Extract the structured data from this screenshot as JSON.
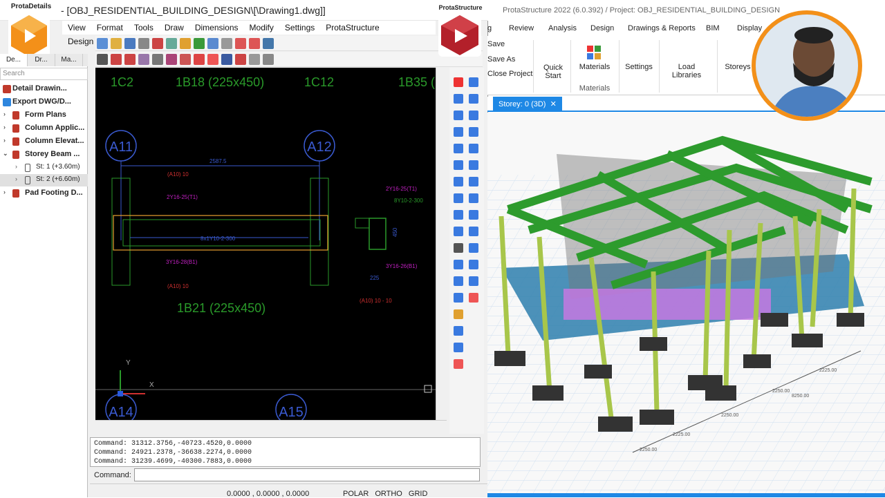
{
  "left_app": {
    "brand": "ProtaDetails",
    "title": "- [OBJ_RESIDENTIAL_BUILDING_DESIGN\\[\\Drawing1.dwg]]",
    "menu": [
      "View",
      "Format",
      "Tools",
      "Draw",
      "Dimensions",
      "Modify",
      "Settings",
      "ProtaStructure",
      "Design Librar"
    ],
    "panel_tabs": [
      "De...",
      "Dr...",
      "Ma..."
    ],
    "search_placeholder": "Search",
    "tree": [
      {
        "label": "Detail Drawin...",
        "color": "#c0392b"
      },
      {
        "label": "Export DWG/D...",
        "color": "#2e86de"
      },
      {
        "label": "Form Plans",
        "color": "#c0392b"
      },
      {
        "label": "Column Applic...",
        "color": "#c0392b"
      },
      {
        "label": "Column Elevat...",
        "color": "#c0392b"
      },
      {
        "label": "Storey Beam ...",
        "color": "#c0392b"
      },
      {
        "label": "St: 1 (+3.60m)",
        "color": "#555"
      },
      {
        "label": "St: 2 (+6.60m)",
        "color": "#555"
      },
      {
        "label": "Pad Footing D...",
        "color": "#c0392b"
      }
    ],
    "drawing": {
      "top_labels": [
        "1C2",
        "1B18 (225x450)",
        "1C12",
        "1B35 ("
      ],
      "grid_bubbles": [
        "A11",
        "A12",
        "A14",
        "A15"
      ],
      "bottom_beam_label": "1B21 (225x450)",
      "dim_top": "2587.5",
      "sect_a": "(A10) 10",
      "sect_b": "(A10) 10",
      "sect_c": "(A10) 10 - 10",
      "bar_top": "2Y16-25(T1)",
      "bar_bottom": "3Y16-28(B1)",
      "stirrups": "8x1Y10-2-300",
      "sec_top": "2Y16-25(T1)",
      "sec_stirrup": "8Y10-2-300",
      "sec_bottom": "3Y16-26(B1)",
      "sec_width": "225",
      "sec_depth": "450",
      "axis_y": "Y",
      "axis_x": "X"
    },
    "commands": [
      "Command: 31312.3756,-40723.4520,0.0000",
      "Command: 24921.2378,-36638.2274,0.0000",
      "Command: 31239.4699,-40300.7883,0.0000"
    ],
    "command_label": "Command:",
    "coords": "0.0000 , 0.0000 , 0.0000",
    "modes": "POLAR  ORTHO  GRID"
  },
  "right_app": {
    "brand": "ProtaStructure",
    "title": "ProtaStructure 2022 (6.0.392) / Project: OBJ_RESIDENTIAL_BUILDING_DESIGN",
    "tabs": [
      "g",
      "Review",
      "Analysis",
      "Design",
      "Drawings & Reports",
      "BIM",
      "Display"
    ],
    "save": "Save",
    "save_as": "Save As",
    "close_project": "Close Project",
    "quick_start": "Quick Start",
    "materials": "Materials",
    "materials_group": "Materials",
    "settings": "Settings",
    "load_libraries": "Load Libraries",
    "storeys": "Storeys",
    "view_tab": "Storey: 0 (3D)",
    "close_x": "✕",
    "dims": [
      "2250.00",
      "2225.00",
      "2250.00",
      "2250.00",
      "2225.00",
      "8250.00"
    ]
  },
  "colors": {
    "accent": "#1e88e5",
    "logo_orange": "#f39019",
    "logo_red": "#b3202a",
    "beam_green": "#2d9b2d",
    "column": "#a8c64a",
    "slab": "#2e7fae",
    "wall": "#c678e0"
  }
}
